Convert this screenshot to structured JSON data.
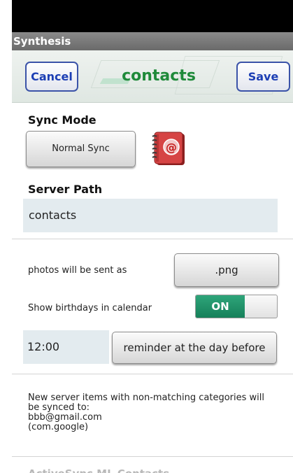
{
  "app": {
    "title": "Synthesis"
  },
  "toolbar": {
    "cancel_label": "Cancel",
    "title": "contacts",
    "save_label": "Save"
  },
  "sync": {
    "label": "Sync Mode",
    "mode_button": "Normal Sync",
    "icon": "address-book-icon"
  },
  "server": {
    "label": "Server Path",
    "value": "contacts"
  },
  "photos": {
    "label": "photos will be sent as",
    "format_button": ".png"
  },
  "birthdays": {
    "label": "Show birthdays in calendar",
    "toggle_text": "ON",
    "toggle_state": true
  },
  "reminder": {
    "time_value": "12:00",
    "button_label": "reminder at the day before"
  },
  "categories": {
    "line1": "New server items with non-matching categories will",
    "line2": "be synced to:",
    "line3": "bbb@gmail.com",
    "line4": "(com.google)"
  },
  "next_section": {
    "heading": "ActiveSync ML Contacts"
  },
  "colors": {
    "accent_green": "#1f8a3a",
    "button_blue": "#1d3fb4",
    "toggle_on": "#16805a",
    "field_bg": "#e3ebef"
  }
}
